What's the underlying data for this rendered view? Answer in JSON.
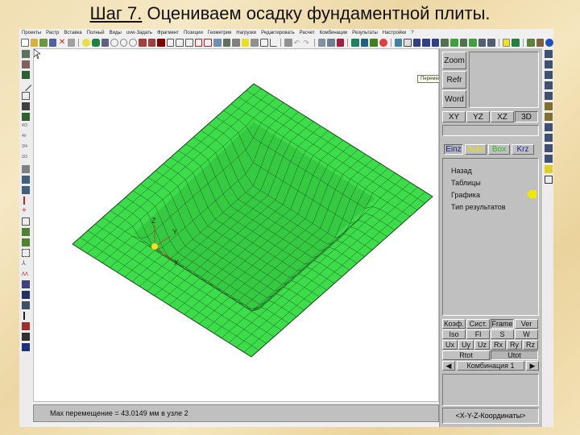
{
  "slide": {
    "step": "Шаг 7.",
    "title": " Оцениваем осадку фундаментной плиты."
  },
  "menu": [
    "Проекты",
    "Растр",
    "Вставка",
    "Полный",
    "Виды",
    "uvw-Задать",
    "Фрагмент",
    "Позиции",
    "Геометрия",
    "Нагрузки",
    "Редактировать",
    "Расчет",
    "Комбинации",
    "Результаты",
    "Настройки",
    "?"
  ],
  "tooltip": "Перемещения узлов",
  "panel": {
    "top_buttons": [
      "Zoom",
      "Refr",
      "Word"
    ],
    "view_tabs": [
      "XY",
      "YZ",
      "XZ",
      "3D"
    ],
    "active_view": "3D",
    "mode_tabs": [
      {
        "label": "Einz",
        "color": "#1a1aa0"
      },
      {
        "label": "Auto",
        "color": "#e8e000"
      },
      {
        "label": "Box",
        "color": "#22c022"
      },
      {
        "label": "Krz",
        "color": "#1a1aa0"
      }
    ],
    "menu_items": [
      "Назад",
      "Таблицы",
      "Графика",
      "Тип результатов"
    ],
    "selected_menu_item": "Графика",
    "result_rows": [
      [
        "Коэф.",
        "Сист.",
        "Frame",
        "Ver"
      ],
      [
        "Iso",
        "Fl",
        "S",
        "W"
      ],
      [
        "Ux",
        "Uy",
        "Uz",
        "Rx",
        "Ry",
        "Rz"
      ],
      [
        "Rtot",
        "Utot"
      ]
    ],
    "combination": "Комбинация 1",
    "prev_arrow": "◀",
    "next_arrow": "▶",
    "coords_label": "<X-Y-Z-Координаты>"
  },
  "viewport": {
    "axis_labels": {
      "z": "Z",
      "y": "Y",
      "x": "X"
    },
    "mesh_color": "#3ddc4a"
  },
  "status": {
    "text": "Max перемещение  = 43.0149 мм в узле 2"
  }
}
